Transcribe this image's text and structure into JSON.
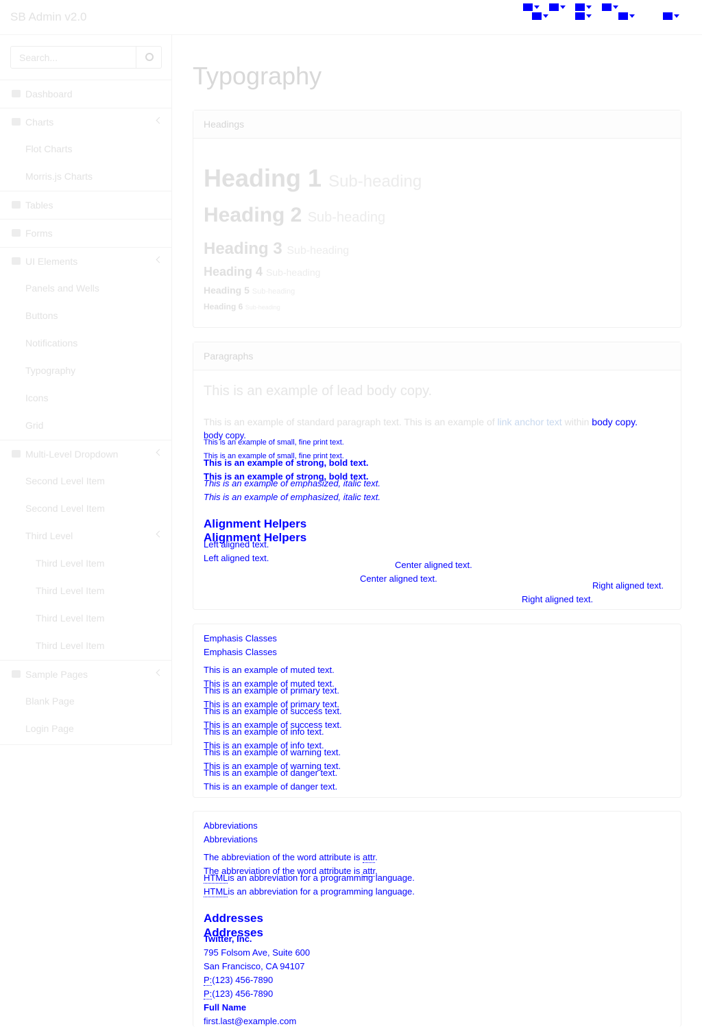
{
  "app": {
    "brand": "SB Admin v2.0"
  },
  "topbar": {
    "icons": [
      "envelope-icon",
      "tasks-icon",
      "bell-icon",
      "user-icon"
    ]
  },
  "search": {
    "placeholder": "Search..."
  },
  "sidebar": {
    "items": [
      {
        "label": "Dashboard"
      },
      {
        "label": "Charts"
      },
      {
        "label": "Flot Charts"
      },
      {
        "label": "Morris.js Charts"
      },
      {
        "label": "Tables"
      },
      {
        "label": "Forms"
      },
      {
        "label": "UI Elements"
      },
      {
        "label": "Panels and Wells"
      },
      {
        "label": "Buttons"
      },
      {
        "label": "Notifications"
      },
      {
        "label": "Typography"
      },
      {
        "label": "Icons"
      },
      {
        "label": "Grid"
      },
      {
        "label": "Multi-Level Dropdown"
      },
      {
        "label": "Second Level Item"
      },
      {
        "label": "Second Level Item"
      },
      {
        "label": "Third Level"
      },
      {
        "label": "Third Level Item"
      },
      {
        "label": "Third Level Item"
      },
      {
        "label": "Third Level Item"
      },
      {
        "label": "Third Level Item"
      },
      {
        "label": "Sample Pages"
      },
      {
        "label": "Blank Page"
      },
      {
        "label": "Login Page"
      }
    ]
  },
  "main": {
    "title": "Typography",
    "headings": {
      "panel_title": "Headings",
      "items": [
        {
          "text": "Heading 1",
          "sub": "Sub-heading"
        },
        {
          "text": "Heading 2",
          "sub": "Sub-heading"
        },
        {
          "text": "Heading 3",
          "sub": "Sub-heading"
        },
        {
          "text": "Heading 4",
          "sub": "Sub-heading"
        },
        {
          "text": "Heading 5",
          "sub": "Sub-heading"
        },
        {
          "text": "Heading 6",
          "sub": "Sub-heading"
        }
      ]
    },
    "paragraphs": {
      "panel_title": "Paragraphs",
      "lead": "This is an example of lead body copy.",
      "standard_prefix": "This is an example of standard paragraph text. This is an example of",
      "link_text": "link anchor text",
      "within": "within",
      "body_copy": "body copy.",
      "small": "This is an example of small, fine print text.",
      "strong": "This is an example of strong, bold text.",
      "emphasized": "This is an example of emphasized, italic text.",
      "alignment_heading": "Alignment Helpers",
      "left": "Left aligned text.",
      "center": "Center aligned text.",
      "right": "Right aligned text."
    },
    "emphasis": {
      "panel_title": "Emphasis Classes",
      "muted": "This is an example of muted text.",
      "primary": "This is an example of primary text.",
      "success": "This is an example of success text.",
      "info": "This is an example of info text.",
      "warning": "This is an example of warning text.",
      "danger": "This is an example of danger text."
    },
    "abbreviations": {
      "panel_title": "Abbreviations",
      "attr_prefix": "The abbreviation of the word attribute is",
      "attr": "attr",
      "html": "HTML",
      "html_suffix": "is an abbreviation for a programming language.",
      "addresses_heading": "Addresses",
      "company": "Twitter, Inc.",
      "street": "795 Folsom Ave, Suite 600",
      "city": "San Francisco, CA 94107",
      "phone_label": "P:",
      "phone": "(123) 456-7890",
      "full_name": "Full Name",
      "email": "first.last@example.com"
    }
  }
}
